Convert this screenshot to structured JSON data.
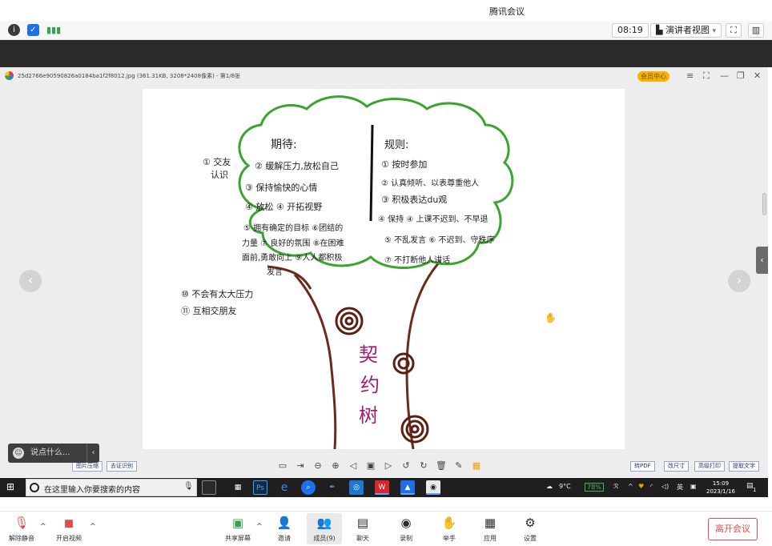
{
  "window": {
    "title": "腾讯会议"
  },
  "top_bar": {
    "timer": "08:19",
    "view_label": "演讲者视图",
    "view_caret": "▾"
  },
  "viewer": {
    "file_info": "25d2766e90590826a0184ba1f2f8012.jpg (361.31KB, 3208*2408像素) - 第1/8张",
    "member_badge": "会员中心",
    "controls": [
      "≡",
      "⛶",
      "—",
      "❐",
      "✕"
    ],
    "prev_arrow": "‹",
    "next_arrow": "›",
    "side_tab": "‹",
    "tool_buttons": [
      "转PDF",
      "改尺寸",
      "高级打印",
      "提取文字"
    ],
    "left_buttons": [
      "图片压缩",
      "去证识别"
    ]
  },
  "drawing": {
    "left_title": "期待:",
    "right_title": "规则:",
    "left_side_note_1": "① 交友",
    "left_side_note_2": "认识",
    "left_items": [
      "② 缓解压力,放松自己",
      "③ 保持愉快的心情",
      "④ 放松  ④ 开拓视野",
      "⑤ 拥有确定的目标 ⑥团结的",
      "力量 ⑦ 良好的氛围 ⑧在困难",
      "面前,勇敢向上 ⑨人人都积极",
      "发言"
    ],
    "right_items": [
      "① 按时参加",
      "② 认真倾听、以表尊重他人",
      "③ 积极表达du观",
      "④ 保持  ④ 上课不迟到、不早退",
      "⑤ 不乱发言  ⑥ 不迟到、守秩序",
      "⑦ 不打断他人讲话"
    ],
    "bottom_items": [
      "⑩ 不会有太大压力",
      "⑪ 互相交朋友"
    ],
    "trunk_text": [
      "契",
      "约",
      "树"
    ]
  },
  "chat": {
    "placeholder": "说点什么...",
    "collapse": "‹"
  },
  "taskbar": {
    "search_placeholder": "在这里输入你要搜索的内容",
    "weather": "9°C",
    "battery": "78%",
    "ime": "英",
    "time": "15:09",
    "date": "2023/1/16",
    "notification_count": "1"
  },
  "bottom_bar": {
    "unmute": "解除静音",
    "start_video": "开启视频",
    "share_screen": "共享屏幕",
    "invite": "邀请",
    "members": "成员(9)",
    "chat": "聊天",
    "record": "录制",
    "raise_hand": "举手",
    "apps": "应用",
    "settings": "设置",
    "leave": "离开会议"
  },
  "colors": {
    "canopy": "#3aa42f",
    "trunk": "#6b2a1a",
    "trunk_text": "#a0197a",
    "leave": "#e24c4c"
  }
}
